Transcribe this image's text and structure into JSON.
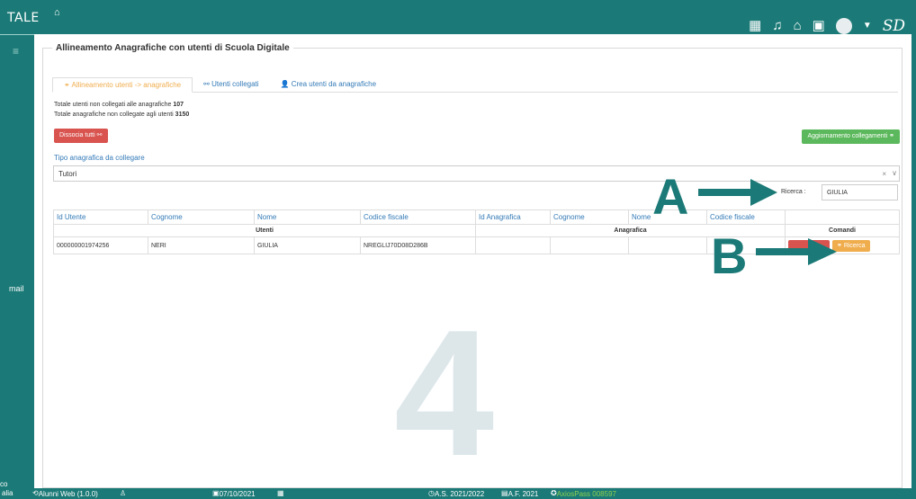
{
  "topbar": {
    "brand": "TALE",
    "home_icon": "home-icon",
    "icons": [
      "building-icon",
      "bell-icon",
      "inbox-icon",
      "calendar-icon",
      "avatar",
      "chevron-down-icon"
    ],
    "logo": "SD"
  },
  "sidebar": {
    "menu_icon": "menu-icon",
    "mail_label": "mail",
    "bottom_label": "co"
  },
  "panel": {
    "legend": "Allineamento Anagrafiche con utenti di Scuola Digitale",
    "tabs": [
      {
        "label": "Allineamento utenti -> anagrafiche",
        "icon": "link-icon",
        "active": true
      },
      {
        "label": "Utenti collegati",
        "icon": "unlink-icon",
        "active": false
      },
      {
        "label": "Crea utenti da anagrafiche",
        "icon": "user-icon",
        "active": false
      }
    ],
    "totals": {
      "non_linked_users_label": "Totale utenti non collegati alle anagrafiche",
      "non_linked_users_value": "107",
      "non_linked_records_label": "Totale anagrafiche non collegate agli utenti",
      "non_linked_records_value": "3150"
    },
    "dissocia_label": "Dissocia tutti",
    "aggiorna_label": "Aggiornamento collegamenti",
    "tipo_label": "Tipo anagrafica da collegare",
    "tipo_value": "Tutori",
    "search": {
      "label": "Ricerca :",
      "value": "GIULIA"
    }
  },
  "table": {
    "headers": [
      "Id Utente",
      "Cognome",
      "Nome",
      "Codice fiscale",
      "Id Anagrafica",
      "Cognome",
      "Nome",
      "Codice fiscale",
      ""
    ],
    "groups": {
      "utenti": "Utenti",
      "anagrafica": "Anagrafica",
      "comandi": "Comandi"
    },
    "rows": [
      {
        "id_utente": "000000001974256",
        "cognome": "NERI",
        "nome": "GIULIA",
        "codice_fiscale": "NREGLIJ70D08D286B",
        "id_anagrafica": "",
        "cognome_a": "",
        "nome_a": "",
        "codice_fiscale_a": ""
      }
    ],
    "ricerca_button": "Ricerca"
  },
  "annotations": {
    "a": "A",
    "b": "B"
  },
  "watermark": "4",
  "statusbar": {
    "left": "alia",
    "app": "Alunni Web (1.0.0)",
    "date": "07/10/2021",
    "as": "A.S. 2021/2022",
    "af": "A.F. 2021",
    "axios": "AxiosPass 008597"
  },
  "colors": {
    "teal": "#1b7a77",
    "red": "#d9534f",
    "green": "#5cb85c",
    "orange": "#f0ad4e",
    "blue": "#337ab7"
  }
}
